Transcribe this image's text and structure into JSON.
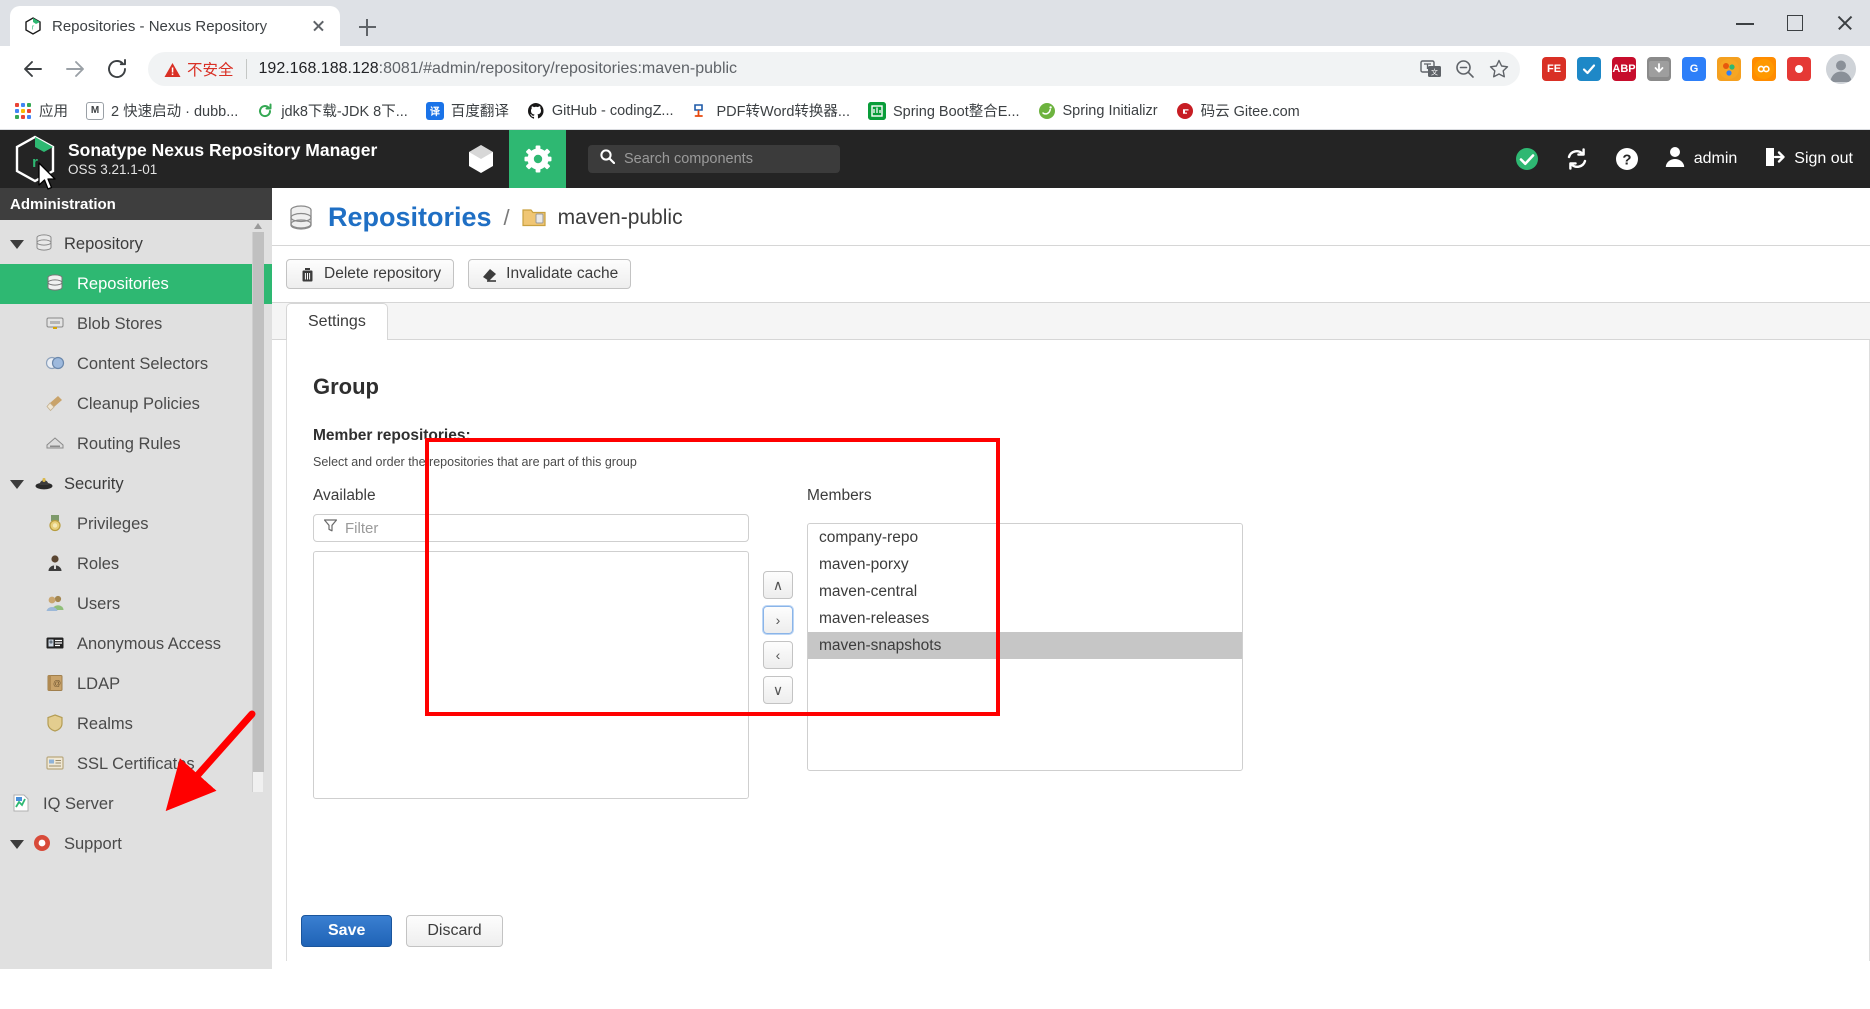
{
  "browser": {
    "tab": {
      "title": "Repositories - Nexus Repository",
      "favicon_name": "nexus-favicon"
    },
    "newtab_label": "+",
    "nav": {
      "back": "Back",
      "forward": "Forward",
      "reload": "Reload"
    },
    "omnibox": {
      "security_label": "不安全",
      "url_host": "192.168.188.128",
      "url_rest": ":8081/#admin/repository/repositories:maven-public"
    },
    "bookmarks": [
      {
        "label": "应用",
        "icon": "apps-grid-icon",
        "color": "#4285f4"
      },
      {
        "label": "2 快速启动 · dubb...",
        "icon": "bookmark-icon",
        "color": "#5f6368"
      },
      {
        "label": "jdk8下载-JDK 8下...",
        "icon": "bookmark-icon",
        "color": "#34a853"
      },
      {
        "label": "百度翻译",
        "icon": "translate-icon",
        "color": "#1a73e8"
      },
      {
        "label": "GitHub - codingZ...",
        "icon": "github-icon",
        "color": "#181717"
      },
      {
        "label": "PDF转Word转换器...",
        "icon": "pdf-icon",
        "color": "#e8480c"
      },
      {
        "label": "Spring Boot整合E...",
        "icon": "bookmark-icon",
        "color": "#0a9d3a"
      },
      {
        "label": "Spring Initializr",
        "icon": "spring-icon",
        "color": "#6db33f"
      },
      {
        "label": "码云 Gitee.com",
        "icon": "gitee-icon",
        "color": "#c71d23"
      }
    ],
    "window": {
      "minimize": "Minimize",
      "maximize": "Maximize",
      "close": "Close"
    }
  },
  "nexus": {
    "header": {
      "title": "Sonatype Nexus Repository Manager",
      "version": "OSS 3.21.1-01",
      "browse_icon": "cube-icon",
      "admin_icon": "gear-icon",
      "search_placeholder": "Search components",
      "status_label": "",
      "refresh_label": "",
      "help_label": "",
      "user_label": "admin",
      "signout_label": "Sign out"
    },
    "sidebar": {
      "title": "Administration",
      "groups": [
        {
          "label": "Repository",
          "icon": "database-icon",
          "items": [
            {
              "label": "Repositories",
              "icon": "database-icon",
              "selected": true
            },
            {
              "label": "Blob Stores",
              "icon": "blobstore-icon",
              "selected": false
            },
            {
              "label": "Content Selectors",
              "icon": "selector-icon",
              "selected": false
            },
            {
              "label": "Cleanup Policies",
              "icon": "broom-icon",
              "selected": false
            },
            {
              "label": "Routing Rules",
              "icon": "routing-icon",
              "selected": false
            }
          ]
        },
        {
          "label": "Security",
          "icon": "security-icon",
          "items": [
            {
              "label": "Privileges",
              "icon": "medal-icon",
              "selected": false
            },
            {
              "label": "Roles",
              "icon": "role-icon",
              "selected": false
            },
            {
              "label": "Users",
              "icon": "users-icon",
              "selected": false
            },
            {
              "label": "Anonymous Access",
              "icon": "card-icon",
              "selected": false
            },
            {
              "label": "LDAP",
              "icon": "book-icon",
              "selected": false
            },
            {
              "label": "Realms",
              "icon": "shield-icon",
              "selected": false
            },
            {
              "label": "SSL Certificates",
              "icon": "certificate-icon",
              "selected": false
            }
          ]
        }
      ],
      "roots": [
        {
          "label": "IQ Server",
          "icon": "iq-icon"
        },
        {
          "label": "Support",
          "icon": "support-icon"
        }
      ]
    },
    "breadcrumb": {
      "root": "Repositories",
      "separator": "/",
      "current": "maven-public"
    },
    "actions": [
      {
        "label": "Delete repository",
        "icon": "trash-icon"
      },
      {
        "label": "Invalidate cache",
        "icon": "eraser-icon"
      }
    ],
    "tabs": [
      {
        "label": "Settings",
        "active": true
      }
    ],
    "form": {
      "section_title": "Group",
      "field_label": "Member repositories:",
      "field_help": "Select and order the repositories that are part of this group",
      "available": {
        "header": "Available",
        "filter_placeholder": "Filter",
        "items": []
      },
      "members": {
        "header": "Members",
        "items": [
          {
            "label": "company-repo",
            "selected": false
          },
          {
            "label": "maven-porxy",
            "selected": false
          },
          {
            "label": "maven-central",
            "selected": false
          },
          {
            "label": "maven-releases",
            "selected": false
          },
          {
            "label": "maven-snapshots",
            "selected": true
          }
        ]
      },
      "transfer_buttons": [
        {
          "name": "move-up",
          "glyph": "∧"
        },
        {
          "name": "move-right",
          "glyph": "›"
        },
        {
          "name": "move-left",
          "glyph": "‹"
        },
        {
          "name": "move-down",
          "glyph": "∨"
        }
      ]
    },
    "footer": {
      "save_label": "Save",
      "discard_label": "Discard"
    },
    "annotations": {
      "highlight_color": "#ff0000",
      "rect_target": "members-list",
      "arrow_target": "save-button"
    }
  }
}
